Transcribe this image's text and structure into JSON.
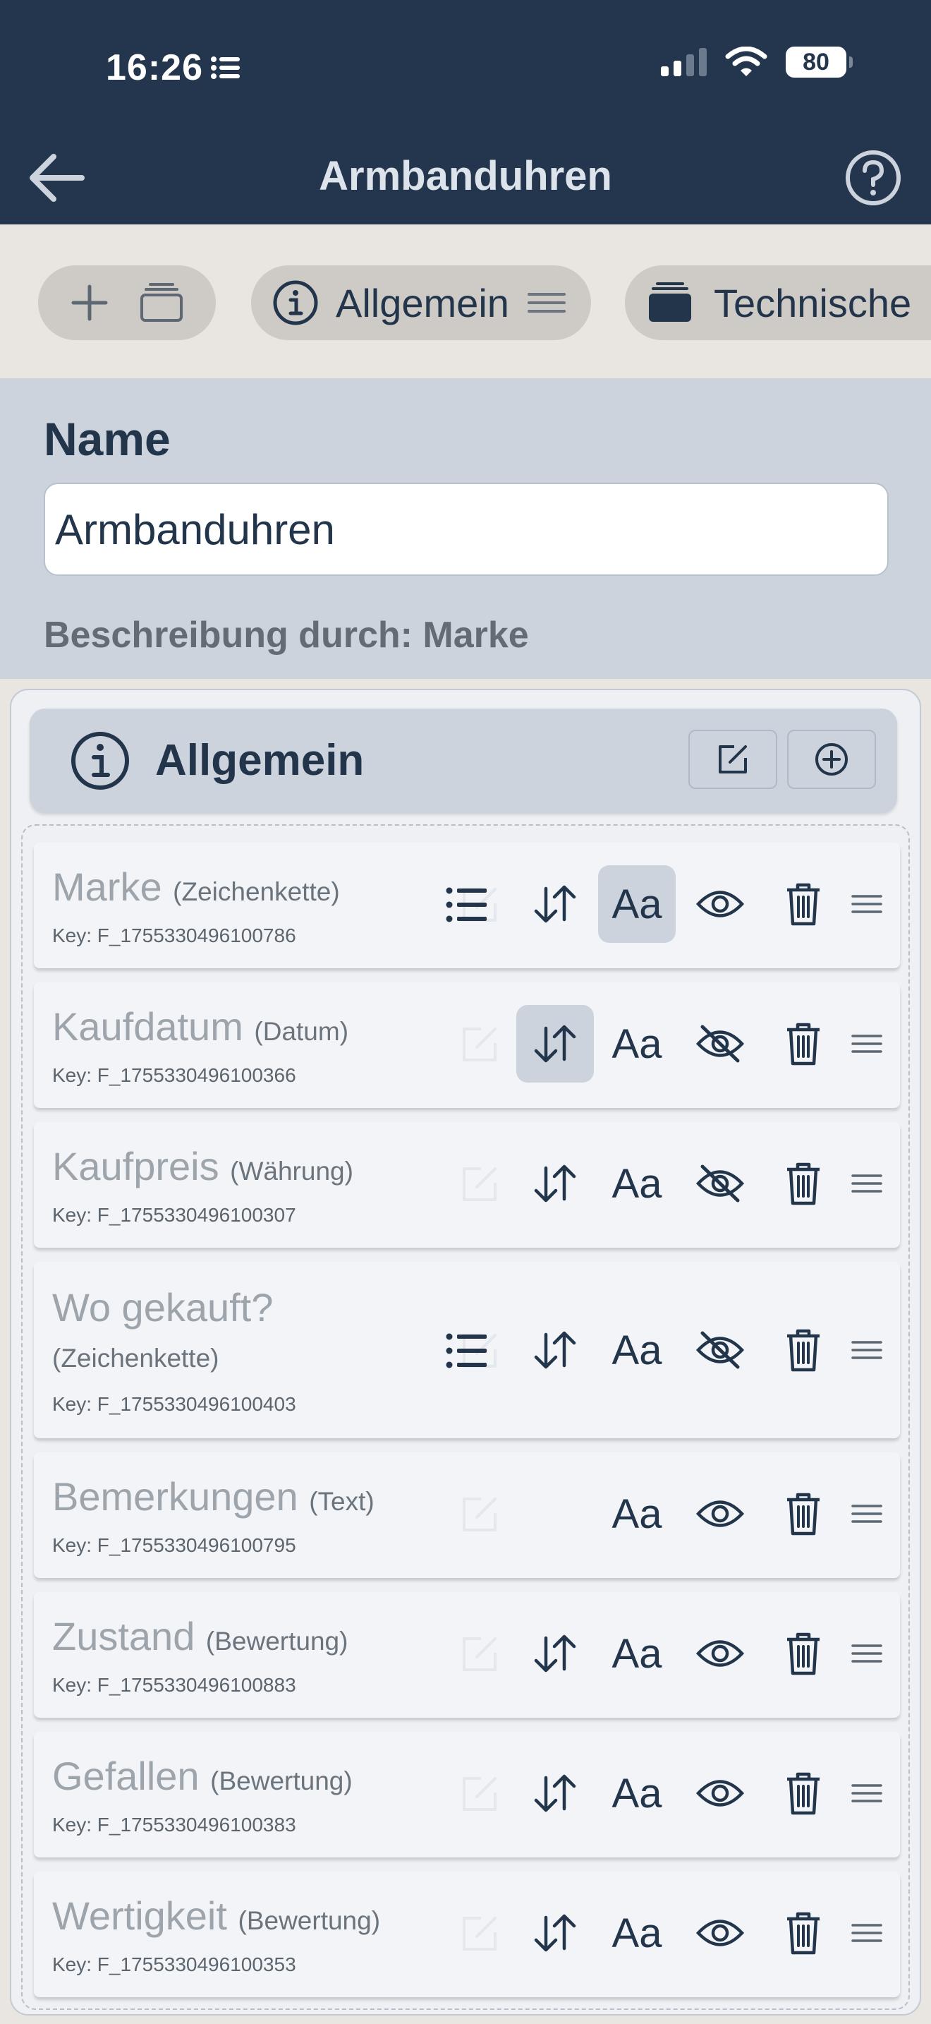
{
  "status_bar": {
    "time": "16:26",
    "battery": "80"
  },
  "nav": {
    "title": "Armbanduhren",
    "back_icon": "arrow-left-icon",
    "help_icon": "question-circle-icon"
  },
  "sections": [
    {
      "label": "Allgemein",
      "icon": "info-circle-icon"
    },
    {
      "label": "Technische",
      "icon": "stack-icon"
    }
  ],
  "name": {
    "label": "Name",
    "value": "Armbanduhren"
  },
  "description": "Beschreibung durch: Marke",
  "group": {
    "title": "Allgemein"
  },
  "fields": [
    {
      "name": "Marke",
      "type": "(Zeichenkette)",
      "key": "Key: F_1755330496100786",
      "list": true,
      "sort": true,
      "visible": true,
      "active": "aa"
    },
    {
      "name": "Kaufdatum",
      "type": "(Datum)",
      "key": "Key: F_1755330496100366",
      "list": false,
      "sort": true,
      "visible": false,
      "active": "sort"
    },
    {
      "name": "Kaufpreis",
      "type": "(Währung)",
      "key": "Key: F_1755330496100307",
      "list": false,
      "sort": true,
      "visible": false,
      "active": ""
    },
    {
      "name": "Wo gekauft?",
      "type": "(Zeichenkette)",
      "key": "Key: F_1755330496100403",
      "list": true,
      "sort": true,
      "visible": false,
      "active": ""
    },
    {
      "name": "Bemerkungen",
      "type": "(Text)",
      "key": "Key: F_1755330496100795",
      "list": false,
      "sort": false,
      "visible": true,
      "active": ""
    },
    {
      "name": "Zustand",
      "type": "(Bewertung)",
      "key": "Key: F_1755330496100883",
      "list": false,
      "sort": true,
      "visible": true,
      "active": ""
    },
    {
      "name": "Gefallen",
      "type": "(Bewertung)",
      "key": "Key: F_1755330496100383",
      "list": false,
      "sort": true,
      "visible": true,
      "active": ""
    },
    {
      "name": "Wertigkeit",
      "type": "(Bewertung)",
      "key": "Key: F_1755330496100353",
      "list": false,
      "sort": true,
      "visible": true,
      "active": ""
    }
  ],
  "field_icons": {
    "list": "list-icon",
    "edit": "edit-icon",
    "sort": "sort-arrows-icon",
    "text_style": "Aa",
    "visible": "eye-icon",
    "hidden": "eye-off-icon",
    "delete": "trash-icon",
    "drag": "drag-handle-icon"
  },
  "colors": {
    "header_bg": "#23364d",
    "accent": "#22354b",
    "panel_bg": "#ccd3dc",
    "strip_bg": "#e9e6e1"
  }
}
